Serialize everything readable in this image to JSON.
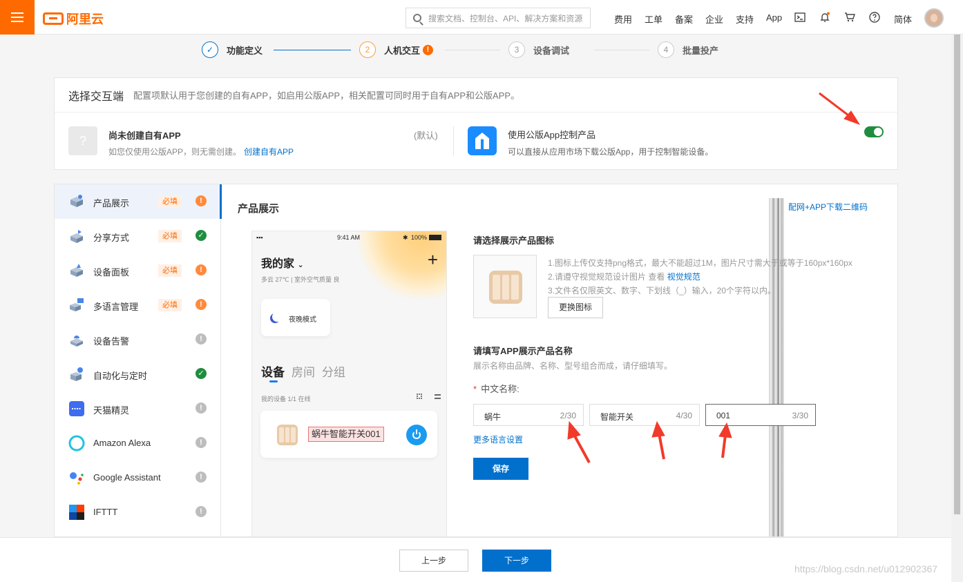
{
  "header": {
    "logo_text": "阿里云",
    "search_placeholder": "搜索文档、控制台、API、解决方案和资源",
    "nav": [
      "费用",
      "工单",
      "备案",
      "企业",
      "支持",
      "App"
    ],
    "lang": "简体"
  },
  "steps": [
    {
      "num": "✓",
      "label": "功能定义",
      "state": "done"
    },
    {
      "num": "2",
      "label": "人机交互",
      "state": "active",
      "warn": "!"
    },
    {
      "num": "3",
      "label": "设备调试",
      "state": "todo"
    },
    {
      "num": "4",
      "label": "批量投产",
      "state": "todo"
    }
  ],
  "interaction": {
    "title": "选择交互端",
    "desc": "配置项默认用于您创建的自有APP，如启用公版APP，相关配置可同时用于自有APP和公版APP。",
    "own_app": {
      "icon": "?",
      "title": "尚未创建自有APP",
      "desc": "如您仅使用公版APP，则无需创建。",
      "link": "创建自有APP",
      "tag": "(默认)"
    },
    "public_app": {
      "title": "使用公版App控制产品",
      "desc": "可以直接从应用市场下载公版App，用于控制智能设备。",
      "enabled": true
    }
  },
  "sidebar": {
    "items": [
      {
        "label": "产品展示",
        "required": "必填",
        "status": "!",
        "kind": "warn",
        "active": true
      },
      {
        "label": "分享方式",
        "required": "必填",
        "status": "✓",
        "kind": "ok"
      },
      {
        "label": "设备面板",
        "required": "必填",
        "status": "!",
        "kind": "warn"
      },
      {
        "label": "多语言管理",
        "required": "必填",
        "status": "!",
        "kind": "warn"
      },
      {
        "label": "设备告警",
        "required": "",
        "status": "!",
        "kind": "info"
      },
      {
        "label": "自动化与定时",
        "required": "",
        "status": "✓",
        "kind": "ok"
      },
      {
        "label": "天猫精灵",
        "required": "",
        "status": "!",
        "kind": "info"
      },
      {
        "label": "Amazon Alexa",
        "required": "",
        "status": "!",
        "kind": "info"
      },
      {
        "label": "Google Assistant",
        "required": "",
        "status": "!",
        "kind": "info"
      },
      {
        "label": "IFTTT",
        "required": "",
        "status": "!",
        "kind": "info"
      }
    ]
  },
  "content": {
    "title": "产品展示",
    "qr_link": "配网+APP下载二维码",
    "phone": {
      "time": "9:41 AM",
      "battery": "100%",
      "home": "我的家",
      "weather": "多云 27℃  |  室外空气质量 良",
      "night_mode": "夜晚模式",
      "tabs": [
        "设备",
        "房间",
        "分组"
      ],
      "my_devices": "我的设备   1/1 在线",
      "device_name": "蜗牛智能开关001"
    },
    "icon_section": {
      "title": "请选择展示产品图标",
      "rule1": "1.图标上传仅支持png格式，最大不能超过1M，图片尺寸需大于或等于160px*160px",
      "rule2_prefix": "2.请遵守视觉规范设计图片 查看 ",
      "rule2_link": "视觉规范",
      "rule3": "3.文件名仅限英文、数字、下划线（_）输入，20个字符以内。",
      "change_button": "更换图标"
    },
    "name_section": {
      "title": "请填写APP展示产品名称",
      "hint": "展示名称由品牌、名称、型号组合而成，请仔细填写。",
      "required_mark": "*",
      "label": "中文名称:",
      "fields": [
        {
          "value": "蜗牛",
          "count": "2/30"
        },
        {
          "value": "智能开关",
          "count": "4/30"
        },
        {
          "value": "001",
          "count": "3/30"
        }
      ],
      "more_lang": "更多语言设置",
      "save": "保存"
    }
  },
  "footer": {
    "prev": "上一步",
    "next": "下一步",
    "watermark": "https://blog.csdn.net/u012902367"
  },
  "colors": {
    "brand": "#ff6a00",
    "primary": "#0070cc",
    "success": "#1e8e3e",
    "annotation": "#f23a2a"
  }
}
